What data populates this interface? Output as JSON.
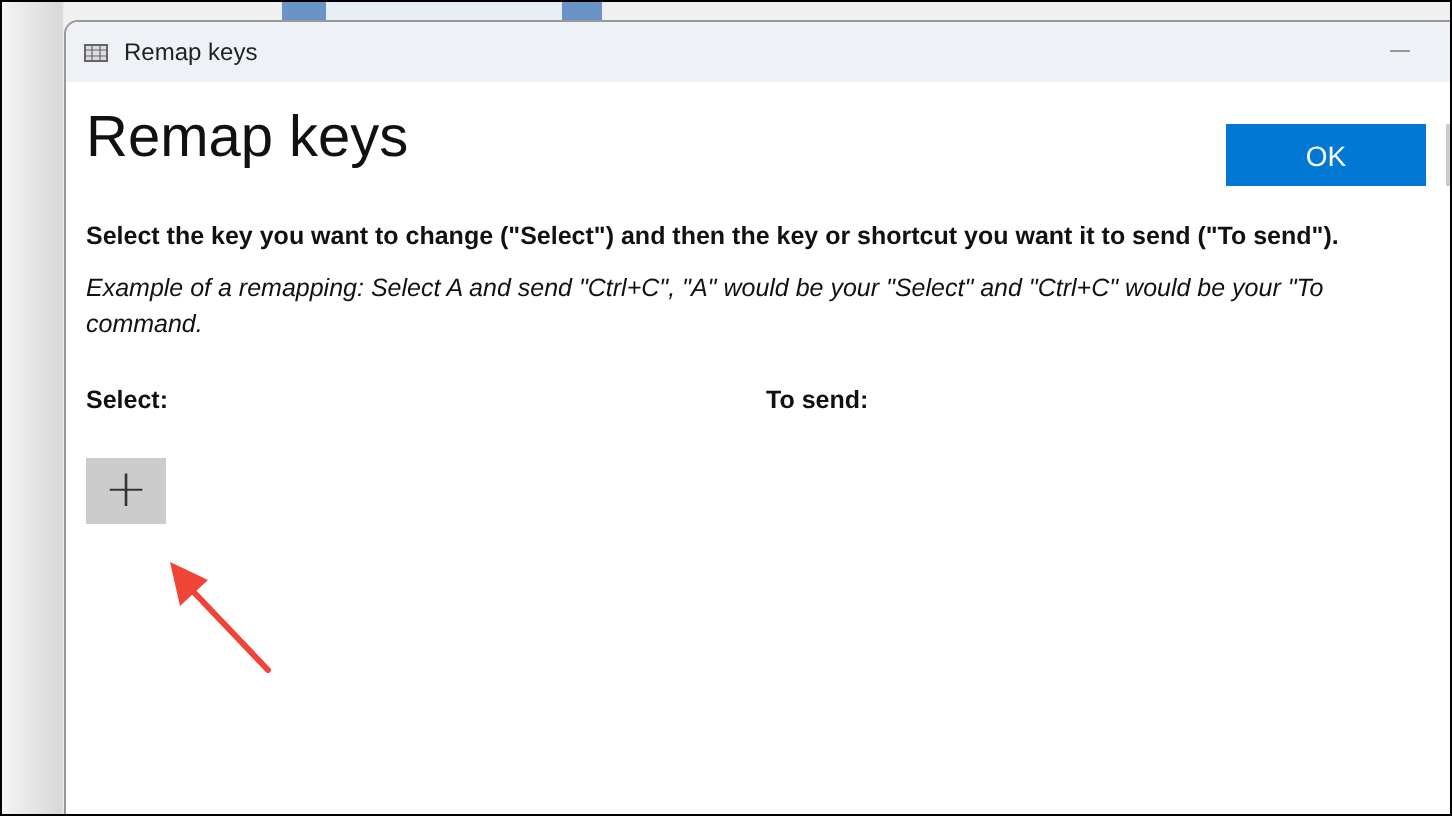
{
  "window": {
    "title": "Remap keys"
  },
  "heading": "Remap keys",
  "buttons": [
    {
      "label": "OK",
      "kind": "primary"
    },
    {
      "kind": "secondary"
    }
  ],
  "instruction": "Select the key you want to change (\"Select\") and then the key or shortcut you want it to send (\"To send\").",
  "example": "Example of a remapping: Select A and send \"Ctrl+C\", \"A\" would be your \"Select\" and \"Ctrl+C\" would be your \"To\ncommand.",
  "columns": [
    {
      "label": "Select:"
    },
    {
      "label": "To send:"
    }
  ],
  "add_button": {
    "label": "+"
  }
}
